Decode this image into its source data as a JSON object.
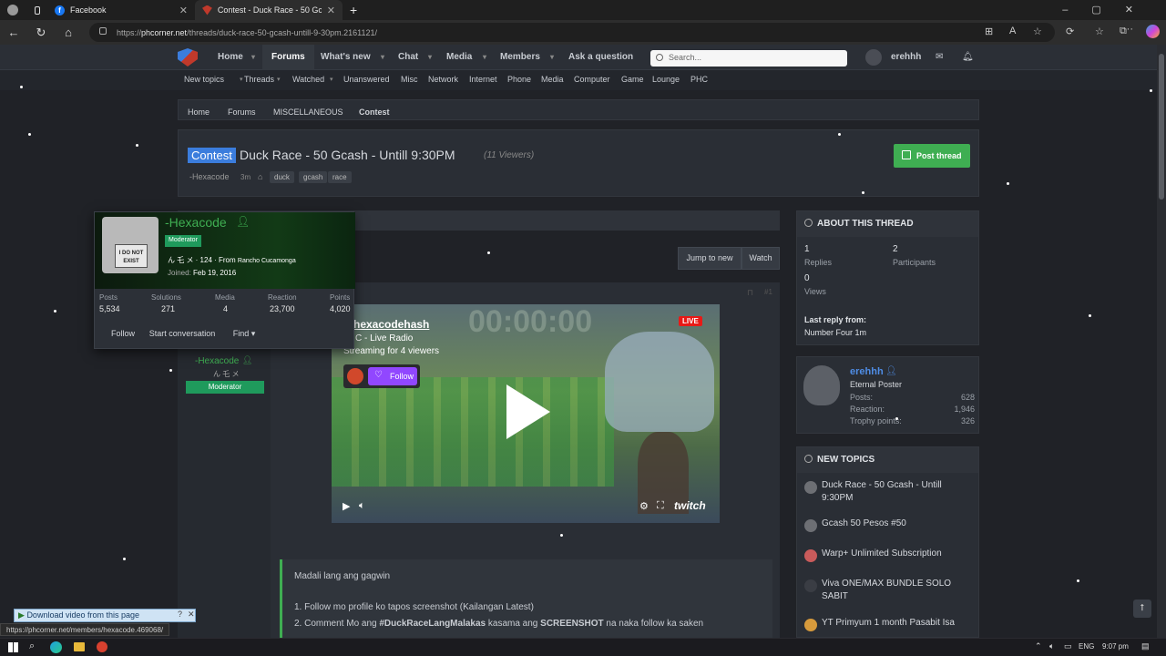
{
  "browser": {
    "tabs": [
      {
        "title": "Facebook"
      },
      {
        "title": "Contest - Duck Race - 50 Gcash -"
      }
    ],
    "url_prefix": "https://",
    "url_host": "phcorner.net",
    "url_path": "/threads/duck-race-50-gcash-untill-9-30pm.2161121/",
    "status_url": "https://phcorner.net/members/hexacode.469068/"
  },
  "sitenav": {
    "items": [
      "Home",
      "Forums",
      "What's new",
      "Chat",
      "Media",
      "Members",
      "Ask a question"
    ],
    "search_placeholder": "Search...",
    "username": "erehhh"
  },
  "subnav": [
    "New topics",
    "Threads",
    "Watched",
    "Unanswered",
    "Misc",
    "Network",
    "Internet",
    "Phone",
    "Media",
    "Computer",
    "Game",
    "Lounge",
    "PHC"
  ],
  "breadcrumb": [
    "Home",
    "Forums",
    "MISCELLANEOUS",
    "Contest"
  ],
  "thread": {
    "prefix": "Contest",
    "title": "Duck Race - 50 Gcash - Untill 9:30PM",
    "viewers": "(11 Viewers)",
    "author": "-Hexacode",
    "age": "3m",
    "tags": [
      "duck",
      "gcash",
      "race"
    ],
    "post_button": "Post thread"
  },
  "actions": {
    "jump": "Jump to new",
    "watch": "Watch"
  },
  "post": {
    "author": "-Hexacode",
    "subtitle": "ん 乇 メ",
    "role": "Moderator",
    "text1": "Madali lang ang gagwin",
    "text2": "1. Follow mo profile ko tapos screenshot (Kailangan Latest)",
    "text3_a": "2. Comment Mo ang ",
    "text3_b": "#DuckRaceLangMalakas",
    "text3_c": " kasama ang ",
    "text3_d": "SCREENSHOT",
    "text3_e": " na naka follow ka saken"
  },
  "video": {
    "channel": "hexacodehash",
    "subtitle": "C - Live Radio",
    "streaming": "Streaming for 4 viewers",
    "follow": "Follow",
    "live": "LIVE",
    "timer": "00:00:00",
    "brand": "twitch"
  },
  "tooltip": {
    "name": "-Hexacode",
    "role": "Moderator",
    "avatar_text": "I DO NOT EXIST",
    "line1": "ん 乇 メ · 124 · From ",
    "location": "Rancho Cucamonga",
    "joined_label": "Joined: ",
    "joined": "Feb 19, 2016",
    "stats": [
      {
        "label": "Posts",
        "value": "5,534"
      },
      {
        "label": "Solutions",
        "value": "271"
      },
      {
        "label": "Media",
        "value": "4"
      },
      {
        "label": "Reaction",
        "value": "23,700"
      },
      {
        "label": "Points",
        "value": "4,020"
      }
    ],
    "buttons": [
      "Follow",
      "Start conversation",
      "Find"
    ]
  },
  "about": {
    "title": "ABOUT THIS THREAD",
    "replies": "1",
    "replies_label": "Replies",
    "participants": "2",
    "participants_label": "Participants",
    "views": "0",
    "views_label": "Views",
    "last_label": "Last reply from:",
    "last_value": "Number Four 1m"
  },
  "profile": {
    "name": "erehhh",
    "title": "Eternal Poster",
    "stats": [
      {
        "label": "Posts:",
        "value": "628"
      },
      {
        "label": "Reaction:",
        "value": "1,946"
      },
      {
        "label": "Trophy points:",
        "value": "326"
      }
    ]
  },
  "new_topics": {
    "title": "NEW TOPICS",
    "items": [
      "Duck Race - 50 Gcash - Untill 9:30PM",
      "Gcash 50 Pesos #50",
      "Warp+ Unlimited Subscription",
      "Viva ONE/MAX BUNDLE SOLO SABIT",
      "YT Primyum 1 month Pasabit Isa"
    ]
  },
  "download_bar": "Download video from this page",
  "taskbar": {
    "lang": "ENG",
    "time": "9:07 pm"
  },
  "colors": {
    "accent": "#3b7ddd",
    "green": "#3fae52",
    "bg": "#202227"
  }
}
